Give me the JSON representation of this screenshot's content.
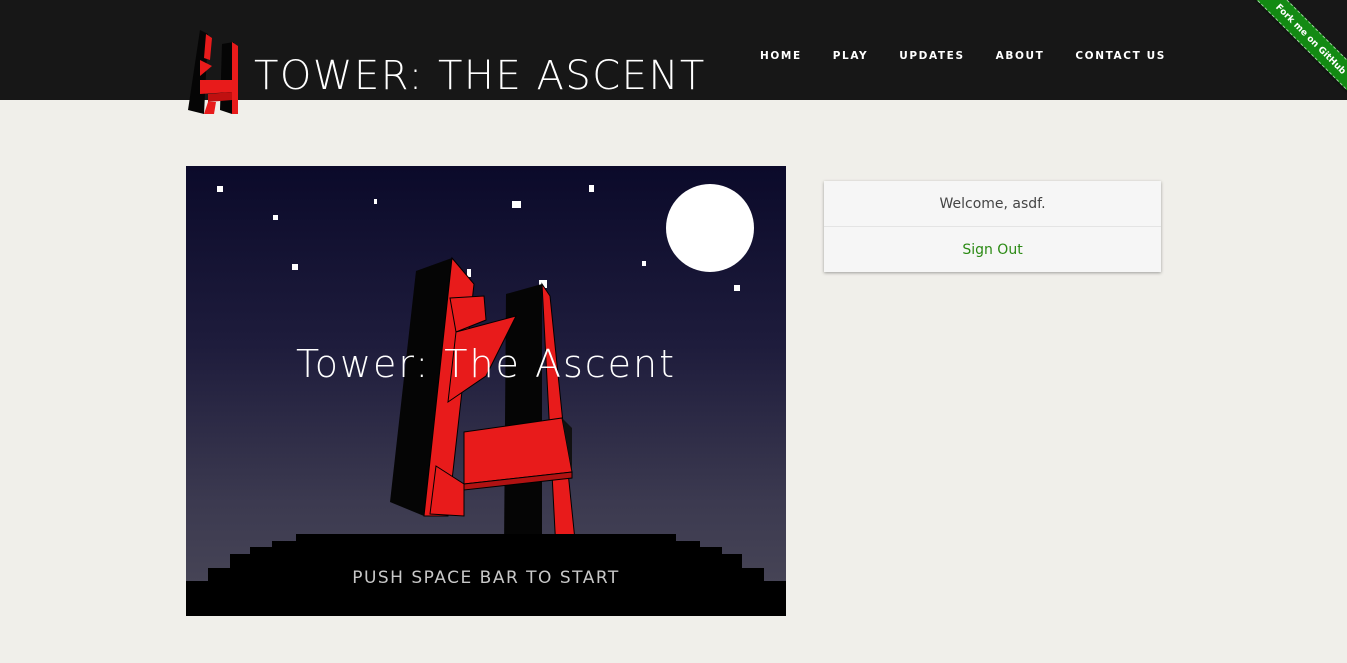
{
  "header": {
    "site_title": "TOWER: THE ASCENT",
    "logo_icon": "tower-logo-icon",
    "nav": [
      {
        "label": "HOME"
      },
      {
        "label": "PLAY"
      },
      {
        "label": "UPDATES"
      },
      {
        "label": "ABOUT"
      },
      {
        "label": "CONTACT US"
      }
    ],
    "ribbon_label": "Fork me on GitHub",
    "ribbon_color": "#138a13"
  },
  "game": {
    "title": "Tower: The Ascent",
    "prompt": "PUSH SPACE BAR TO START",
    "accent_color": "#f0191c",
    "moon_color": "#ffffff"
  },
  "account_card": {
    "welcome_text": "Welcome, asdf.",
    "sign_out_label": "Sign Out",
    "link_color": "#2b8a14"
  }
}
